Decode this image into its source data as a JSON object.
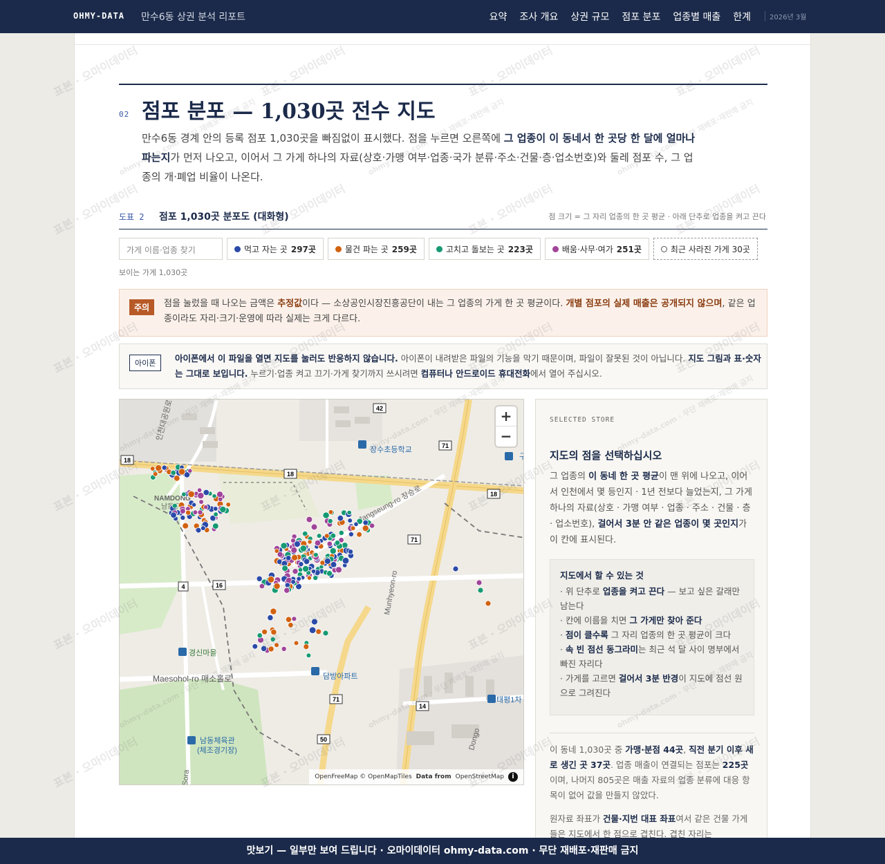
{
  "topbar": {
    "brand": "OHMY-DATA",
    "report_title": "만수6동 상권 분석 리포트",
    "nav": [
      "요약",
      "조사 개요",
      "상권 규모",
      "점포 분포",
      "업종별 매출",
      "한계"
    ],
    "date": "2026년 3월"
  },
  "section": {
    "number": "02",
    "title": "점포 분포 — 1,030곳 전수 지도",
    "lead_1": "만수6동 경계 안의 등록 점포 1,030곳을 빠짐없이 표시했다. 점을 누르면 오른쪽에 ",
    "lead_bold": "그 업종이 이 동네서 한 곳당 한 달에 얼마나 파는지",
    "lead_2": "가 먼저 나오고, 이어서 그 가게 하나의 자료(상호·가맹 여부·업종·국가 분류·주소·건물·층·업소번호)와 둘레 점포 수, 그 업종의 개·폐업 비율이 나온다."
  },
  "figure": {
    "label": "도표 2",
    "title": "점포 1,030곳 분포도 (대화형)",
    "note": "점 크기 = 그 자리 업종의 한 곳 평균 · 아래 단추로 업종을 켜고 끈다",
    "search_placeholder": "가게 이름·업종 찾기",
    "chips": [
      {
        "label": "먹고 자는 곳",
        "count": "297곳",
        "color": "#2a4aa8"
      },
      {
        "label": "물건 파는 곳",
        "count": "259곳",
        "color": "#d2620f"
      },
      {
        "label": "고치고 돌보는 곳",
        "count": "223곳",
        "color": "#169a73"
      },
      {
        "label": "배움·사무·여가",
        "count": "251곳",
        "color": "#a0449a"
      }
    ],
    "closed_chip": "최근 사라진 가게 30곳",
    "visible_count": "보이는 가게 1,030곳"
  },
  "warning": {
    "tag": "주의",
    "text_1": "점을 눌렀을 때 나오는 금액은 ",
    "bold_1": "추정값",
    "text_2": "이다 — 소상공인시장진흥공단이 내는 그 업종의 가게 한 곳 평균이다. ",
    "bold_2": "개별 점포의 실제 매출은 공개되지 않으며",
    "text_3": ", 같은 업종이라도 자리·크기·운영에 따라 실제는 크게 다르다."
  },
  "ios_notice": {
    "tag": "아이폰",
    "bold_1": "아이폰에서 이 파일을 열면 지도를 눌러도 반응하지 않습니다.",
    "text_1": " 아이폰이 내려받은 파일의 기능을 막기 때문이며, 파일이 잘못된 것이 아닙니다. ",
    "bold_2": "지도 그림과 표·숫자는 그대로 보입니다.",
    "text_2": " 누르기·업종 켜고 끄기·가게 찾기까지 쓰시려면 ",
    "bold_3": "컴퓨터나 안드로이드 휴대전화",
    "text_3": "에서 열어 주십시오."
  },
  "map": {
    "zoom_in": "+",
    "zoom_out": "−",
    "attribution_1": "OpenFreeMap © OpenMapTiles",
    "attribution_2": "Data from",
    "attribution_3": "OpenStreetMap",
    "info": "i",
    "labels": {
      "school": "장수초등학교",
      "namdong_en": "NAMDONG",
      "namdong_ko": "남동구",
      "road_jangseung": "Jangseung-ro 장승로",
      "mountain": "경신마을",
      "road_maesohol": "Maesohol-ro 매소홀로",
      "apt": "담방아파트",
      "gym_1": "남동체육관",
      "gym_2": "(체조경기장)",
      "taepyeong": "태평1차",
      "road_v": "Munhyeon-ro",
      "road_dongo": "Dongo",
      "road_sora": "Sora",
      "partial_l": "인천대공원로",
      "partial_r": "구"
    },
    "shields": [
      "42",
      "71",
      "18",
      "18",
      "18",
      "71",
      "4",
      "16",
      "71",
      "14",
      "50"
    ]
  },
  "panel": {
    "label": "SELECTED STORE",
    "title": "지도의 점을 선택하십시오",
    "desc_1": "그 업종의 ",
    "desc_bold_1": "이 동네 한 곳 평균",
    "desc_2": "이 맨 위에 나오고, 이어서 인천에서 몇 등인지 · 1년 전보다 늘었는지, 그 가게 하나의 자료(상호 · 가맹 여부 · 업종 · 주소 · 건물 · 층 · 업소번호), ",
    "desc_bold_2": "걸어서 3분 안 같은 업종이 몇 곳인지",
    "desc_3": "가 이 칸에 표시된다.",
    "howto_title": "지도에서 할 수 있는 것",
    "howto": [
      {
        "pre": "· 위 단추로 ",
        "bold": "업종을 켜고 끈다",
        "post": " — 보고 싶은 갈래만 남는다"
      },
      {
        "pre": "· 칸에 이름을 치면 ",
        "bold": "그 가게만 찾아 준다",
        "post": ""
      },
      {
        "pre": "· ",
        "bold": "점이 클수록",
        "post": " 그 자리 업종의 한 곳 평균이 크다"
      },
      {
        "pre": "· ",
        "bold": "속 빈 점선 동그라미",
        "post": "는 최근 석 달 사이 명부에서 빠진 자리다"
      },
      {
        "pre": "· 가게를 고르면 ",
        "bold": "걸어서 3분 반경",
        "post": "이 지도에 점선 원으로 그려진다"
      }
    ],
    "stats_1": "이 동네 1,030곳 중 ",
    "stats_bold_1": "가맹·분점 44곳",
    "stats_2": ", ",
    "stats_bold_2": "직전 분기 이후 새로 생긴 곳 37곳",
    "stats_3": ". 업종 매출이 연결되는 점포는 ",
    "stats_bold_3": "225곳",
    "stats_4": "이며, 나머지 805곳은 매출 자료의 업종 분류에 대응 항목이 없어 값을 만들지 않았다.",
    "note_1": "원자료 좌표가 ",
    "note_bold": "건물·지번 대표 좌표",
    "note_2": "여서 같은 건물 가게들은 지도에서 한 점으로 겹친다. 겹친 자리는"
  },
  "watermark": {
    "text": "표본 · 오마이데이터",
    "small": "ohmy-data.com · 무단 재배포·재판매 금지"
  },
  "footer": {
    "text": "맛보기 — 일부만 보여 드립니다 · 오마이데이터 ohmy-data.com · 무단 재배포·재판매 금지"
  },
  "colors": {
    "navy": "#1b2a4a",
    "food": "#2a4aa8",
    "retail": "#d2620f",
    "service": "#169a73",
    "edu": "#a0449a",
    "warn": "#b75a27"
  }
}
